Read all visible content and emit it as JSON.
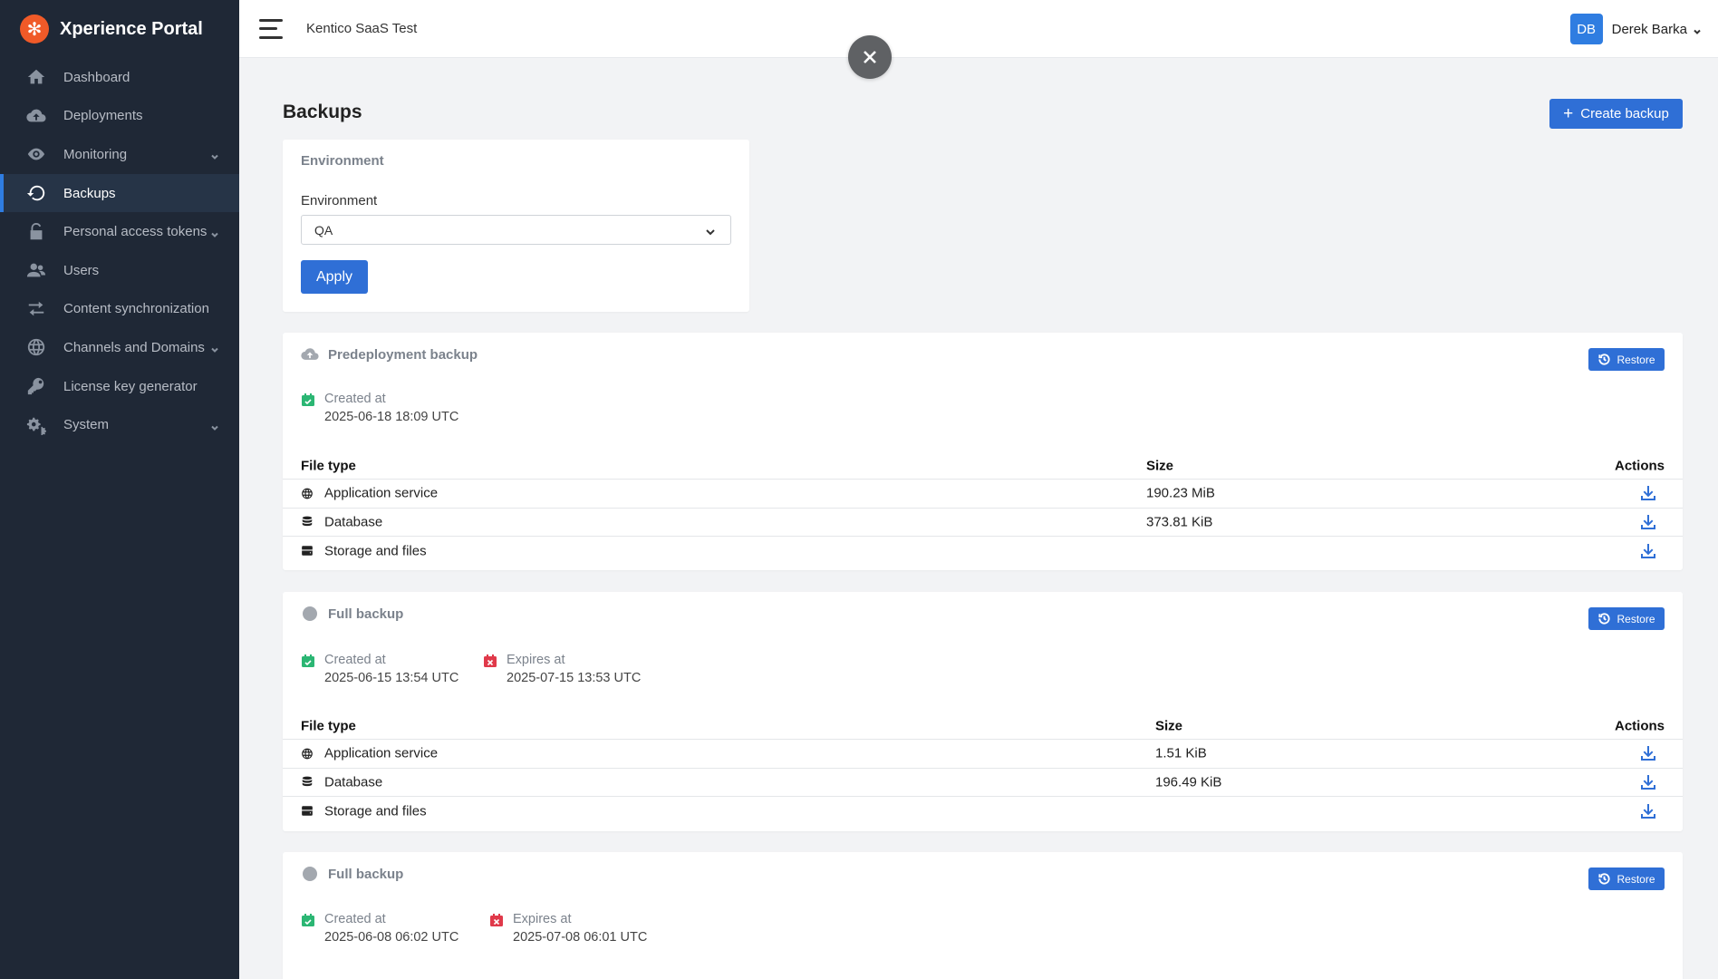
{
  "app": {
    "name": "Xperience Portal"
  },
  "sidebar": {
    "items": [
      {
        "label": "Dashboard",
        "icon": "home-icon"
      },
      {
        "label": "Deployments",
        "icon": "cloud-upload-icon"
      },
      {
        "label": "Monitoring",
        "icon": "eye-icon",
        "expandable": true
      },
      {
        "label": "Backups",
        "icon": "restore-icon",
        "active": true
      },
      {
        "label": "Personal access tokens",
        "icon": "lock-icon",
        "expandable": true
      },
      {
        "label": "Users",
        "icon": "users-icon"
      },
      {
        "label": "Content synchronization",
        "icon": "sync-icon"
      },
      {
        "label": "Channels and Domains",
        "icon": "globe-icon",
        "expandable": true
      },
      {
        "label": "License key generator",
        "icon": "key-icon"
      },
      {
        "label": "System",
        "icon": "gears-icon",
        "expandable": true
      }
    ]
  },
  "header": {
    "project": "Kentico SaaS Test",
    "user": {
      "initials": "DB",
      "name": "Derek Barka"
    }
  },
  "page": {
    "title": "Backups",
    "create_label": "Create backup"
  },
  "filter": {
    "heading": "Environment",
    "label": "Environment",
    "value": "QA",
    "apply_label": "Apply"
  },
  "table_headers": {
    "file_type": "File type",
    "size": "Size",
    "actions": "Actions"
  },
  "restore_label": "Restore",
  "backups": [
    {
      "title": "Predeployment backup",
      "icon": "cloud-upload-icon",
      "created_label": "Created at",
      "created": "2025-06-18 18:09 UTC",
      "files": [
        {
          "type": "Application service",
          "icon": "globe-icon",
          "size": "190.23 MiB"
        },
        {
          "type": "Database",
          "icon": "database-icon",
          "size": "373.81 KiB"
        },
        {
          "type": "Storage and files",
          "icon": "storage-icon",
          "size": ""
        }
      ]
    },
    {
      "title": "Full backup",
      "icon": "circle-icon",
      "created_label": "Created at",
      "created": "2025-06-15 13:54 UTC",
      "expires_label": "Expires at",
      "expires": "2025-07-15 13:53 UTC",
      "files": [
        {
          "type": "Application service",
          "icon": "globe-icon",
          "size": "1.51 KiB"
        },
        {
          "type": "Database",
          "icon": "database-icon",
          "size": "196.49 KiB"
        },
        {
          "type": "Storage and files",
          "icon": "storage-icon",
          "size": ""
        }
      ]
    },
    {
      "title": "Full backup",
      "icon": "circle-icon",
      "created_label": "Created at",
      "created": "2025-06-08 06:02 UTC",
      "expires_label": "Expires at",
      "expires": "2025-07-08 06:01 UTC"
    }
  ],
  "colors": {
    "sidebar_bg": "#1f2836",
    "accent": "#2f6fd6",
    "brand": "#f05a28",
    "created_icon": "#2bb673",
    "expires_icon": "#e0394a"
  }
}
